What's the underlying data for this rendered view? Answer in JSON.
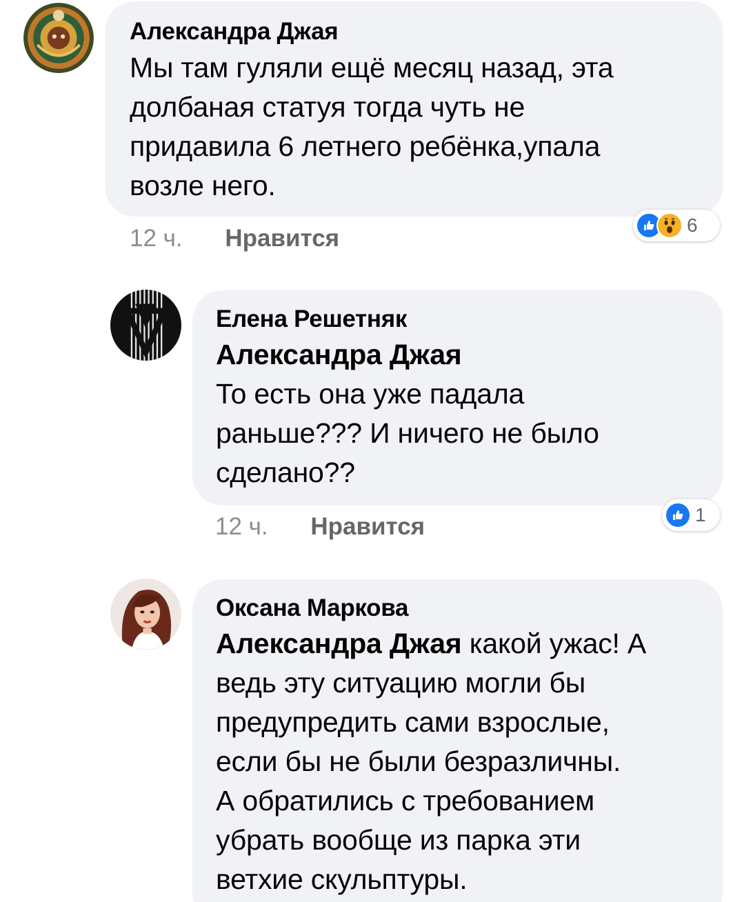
{
  "comments": [
    {
      "author": "Александра Джая",
      "mention": "",
      "lines": [
        "Мы там гуляли ещё месяц назад, эта",
        "долбаная статуя тогда чуть не",
        "придавила 6 летнего ребёнка,упала",
        "возле него."
      ],
      "time": "12 ч.",
      "like_label": "Нравится",
      "reaction_count": "6",
      "reactions": [
        "like-icon",
        "wow-icon"
      ]
    },
    {
      "author": "Елена Решетняк",
      "mention": "Александра Джая",
      "lines": [
        "То есть она уже падала",
        "раньше??? И ничего не было",
        "сделано??"
      ],
      "time": "12 ч.",
      "like_label": "Нравится",
      "reaction_count": "1",
      "reactions": [
        "like-icon"
      ]
    },
    {
      "author": "Оксана Маркова",
      "mention": "Александра Джая",
      "first_line_rest": " какой ужас! А",
      "lines": [
        "ведь эту ситуацию могли бы",
        "предупредить сами взрослые,",
        "если бы не были безразличны.",
        "А обратились с требованием",
        "убрать вообще из парка эти",
        "ветхие скульптуры."
      ]
    }
  ],
  "colors": {
    "bubble": "#f0f2f5",
    "like_blue": "#1877f2",
    "wow_yellow": "#f7b125",
    "meta_gray": "#65676b"
  }
}
